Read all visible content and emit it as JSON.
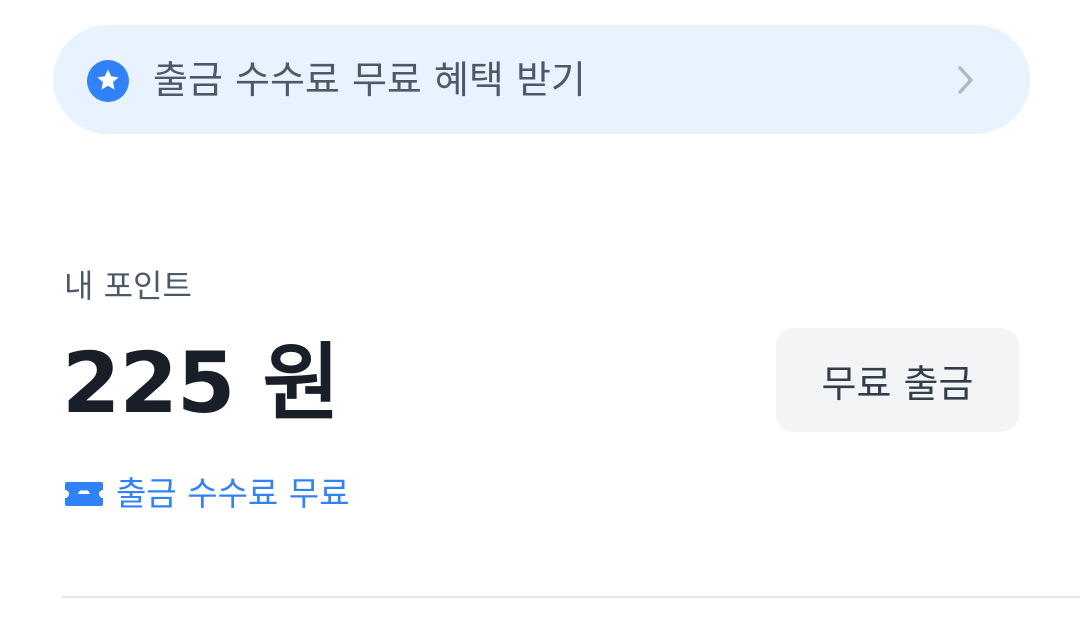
{
  "banner": {
    "text": "출금 수수료 무료 혜택 받기",
    "icon": "star-badge-icon",
    "chevron_icon": "chevron-right-icon",
    "accent_color": "#3182f6",
    "background_color": "#e8f3ff"
  },
  "points": {
    "label": "내 포인트",
    "amount": "225 원"
  },
  "actions": {
    "withdraw_label": "무료 출금"
  },
  "fee_notice": {
    "icon": "ticket-icon",
    "text": "출금 수수료 무료",
    "color": "#3182f6"
  }
}
